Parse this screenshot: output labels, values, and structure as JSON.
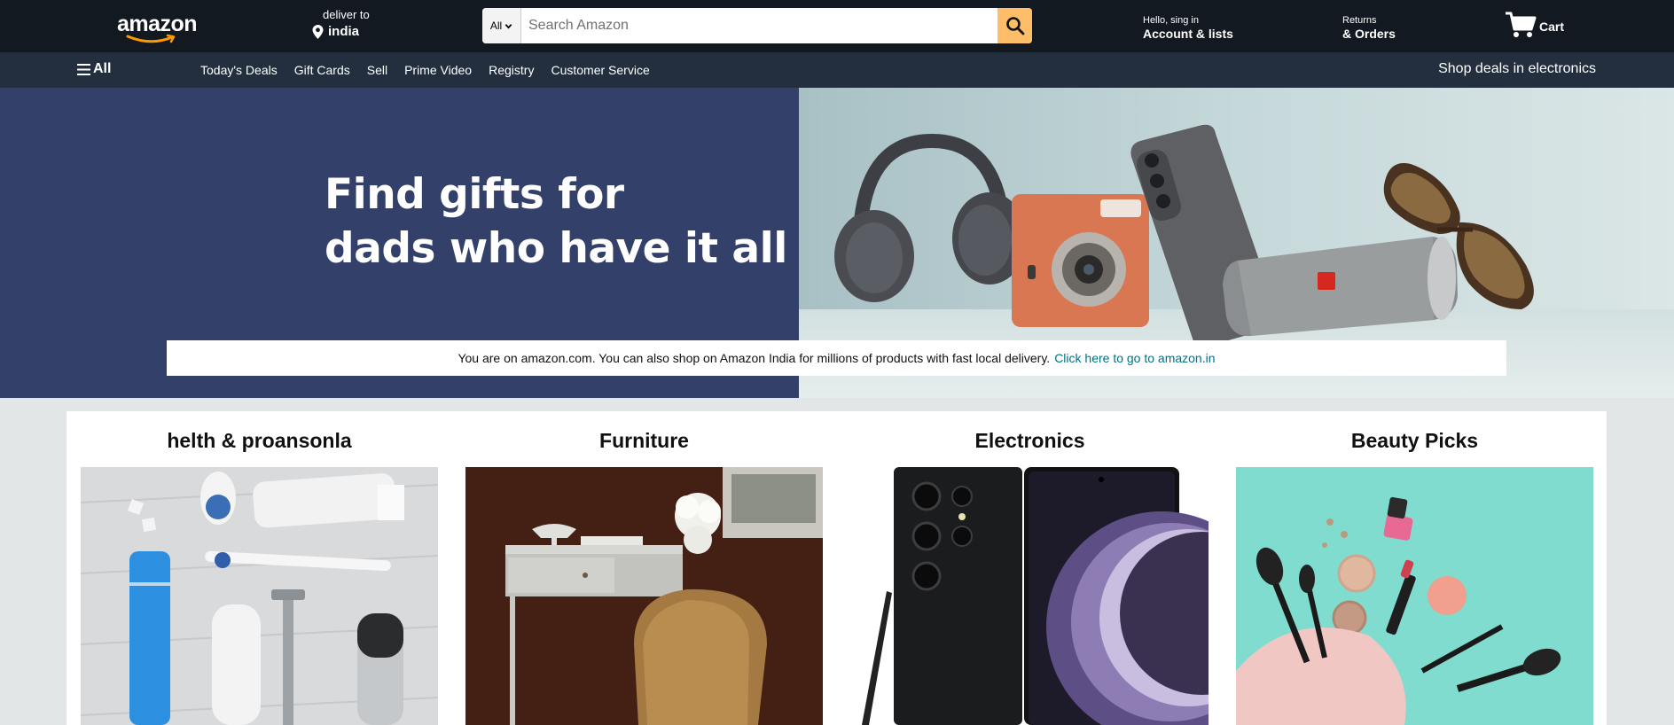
{
  "header": {
    "logo": "amazon",
    "deliver_label": "deliver to",
    "deliver_location": "india",
    "search": {
      "category": "All",
      "placeholder": "Search Amazon"
    },
    "account_greeting": "Hello, sing in",
    "account_label": "Account & lists",
    "returns_label": "Returns",
    "orders_label": "& Orders",
    "cart_label": "Cart"
  },
  "subnav": {
    "all_label": "All",
    "links": [
      "Today's Deals",
      "Gift Cards",
      "Sell",
      "Prime Video",
      "Registry",
      "Customer Service"
    ],
    "promo": "Shop deals in electronics"
  },
  "hero": {
    "title_line1": "Find gifts for",
    "title_line2": "dads who have it all",
    "notice_text": "You are on amazon.com. You can also shop on Amazon India for millions of products with fast local delivery.",
    "notice_link": "Click here to go to amazon.in"
  },
  "cards": [
    {
      "title": "helth & proansonla"
    },
    {
      "title": "Furniture"
    },
    {
      "title": "Electronics"
    },
    {
      "title": "Beauty Picks"
    }
  ],
  "colors": {
    "nav_dark": "#131921",
    "subnav": "#232f3e",
    "search_button": "#febd69",
    "hero_panel": "#33406a",
    "link": "#007185"
  }
}
